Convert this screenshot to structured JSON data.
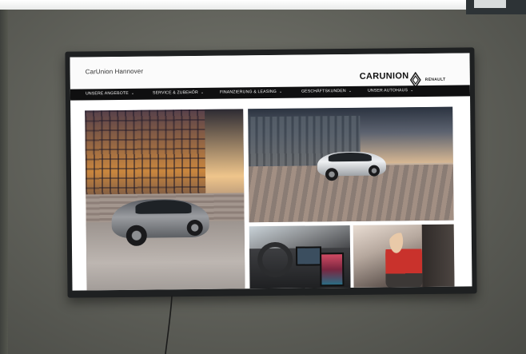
{
  "site": {
    "name": "CarUnion Hannover",
    "brand": "CARUNION",
    "partner": "RENAULT"
  },
  "nav": {
    "items": [
      {
        "label": "UNSERE ANGEBOTE"
      },
      {
        "label": "SERVICE & ZUBEHÖR"
      },
      {
        "label": "FINANZIERUNG & LEASING"
      },
      {
        "label": "GESCHÄFTSKUNDEN"
      },
      {
        "label": "UNSER AUTOHAUS"
      }
    ],
    "chevron": "chevron-down-icon"
  },
  "colors": {
    "nav_bg": "#0f0f10",
    "header_bg": "#fbfbfb",
    "wall": "#62635c",
    "tv_bezel": "#1e2021"
  }
}
